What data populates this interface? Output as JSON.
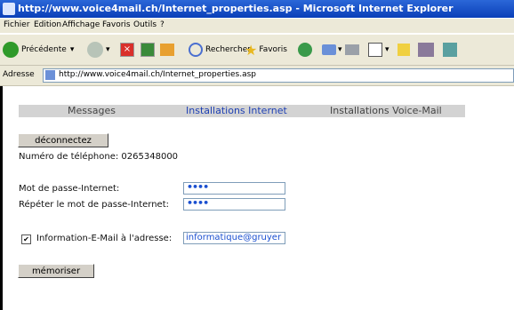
{
  "window": {
    "title": "http://www.voice4mail.ch/Internet_properties.asp - Microsoft Internet Explorer"
  },
  "menu": {
    "items": [
      "Fichier",
      "Edition",
      "Affichage",
      "Favoris",
      "Outils",
      "?"
    ]
  },
  "toolbar": {
    "back_label": "Précédente",
    "search_label": "Rechercher",
    "favorites_label": "Favoris"
  },
  "address": {
    "label": "Adresse",
    "url": "http://www.voice4mail.ch/Internet_properties.asp"
  },
  "nav": {
    "messages": "Messages",
    "internet": "Installations Internet",
    "voicemail": "Installations Voice-Mail"
  },
  "page": {
    "disconnect_label": "déconnectez",
    "phone_label": "Numéro de téléphone: 0265348000",
    "password_label": "Mot de passe-Internet:",
    "password_value": "••••",
    "repeat_label": "Répéter le mot de passe-Internet:",
    "repeat_value": "••••",
    "email_checkbox_label": "Information-E-Mail à l'adresse:",
    "email_checked": true,
    "email_value": "informatique@gruyer",
    "save_label": "mémoriser"
  },
  "colors": {
    "title_bar": "#0a3fb8",
    "chrome": "#ece9d8",
    "active_tab": "#1d3fb3",
    "nav_bg": "#d3d3d3"
  }
}
